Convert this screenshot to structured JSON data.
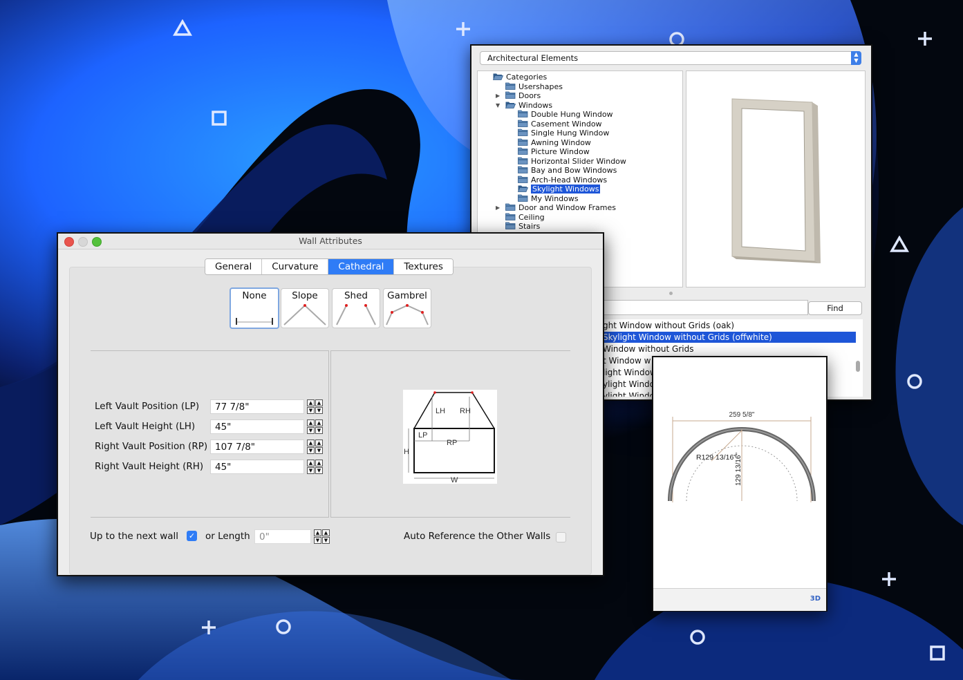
{
  "architectural_elements": {
    "category_select": "Architectural Elements",
    "tree": [
      {
        "label": "Categories",
        "indent": 0,
        "arrow": "",
        "open": true,
        "selected": false
      },
      {
        "label": "Usershapes",
        "indent": 1,
        "arrow": "",
        "open": false,
        "selected": false
      },
      {
        "label": "Doors",
        "indent": 1,
        "arrow": "▶",
        "open": false,
        "selected": false
      },
      {
        "label": "Windows",
        "indent": 1,
        "arrow": "▼",
        "open": true,
        "selected": false
      },
      {
        "label": "Double Hung Window",
        "indent": 2,
        "arrow": "",
        "open": false,
        "selected": false
      },
      {
        "label": "Casement Window",
        "indent": 2,
        "arrow": "",
        "open": false,
        "selected": false
      },
      {
        "label": "Single Hung Window",
        "indent": 2,
        "arrow": "",
        "open": false,
        "selected": false
      },
      {
        "label": "Awning Window",
        "indent": 2,
        "arrow": "",
        "open": false,
        "selected": false
      },
      {
        "label": "Picture Window",
        "indent": 2,
        "arrow": "",
        "open": false,
        "selected": false
      },
      {
        "label": "Horizontal Slider Window",
        "indent": 2,
        "arrow": "",
        "open": false,
        "selected": false
      },
      {
        "label": "Bay and Bow Windows",
        "indent": 2,
        "arrow": "",
        "open": false,
        "selected": false
      },
      {
        "label": "Arch-Head Windows",
        "indent": 2,
        "arrow": "",
        "open": false,
        "selected": false
      },
      {
        "label": "Skylight Windows",
        "indent": 2,
        "arrow": "",
        "open": true,
        "selected": true
      },
      {
        "label": "My Windows",
        "indent": 2,
        "arrow": "",
        "open": false,
        "selected": false
      },
      {
        "label": "Door and Window Frames",
        "indent": 1,
        "arrow": "▶",
        "open": false,
        "selected": false
      },
      {
        "label": "Ceiling",
        "indent": 1,
        "arrow": "",
        "open": false,
        "selected": false
      },
      {
        "label": "Stairs",
        "indent": 1,
        "arrow": "",
        "open": false,
        "selected": false
      }
    ],
    "find_label": "Find",
    "results": [
      {
        "label": "ght Window without Grids (oak)",
        "selected": false
      },
      {
        "label": "Skylight Window without Grids (offwhite)",
        "selected": true
      },
      {
        "label": "Window without Grids",
        "selected": false
      },
      {
        "label": "t Window w",
        "selected": false
      },
      {
        "label": "light Window",
        "selected": false
      },
      {
        "label": "ylight Windo",
        "selected": false
      },
      {
        "label": "ylight Windo",
        "selected": false
      }
    ]
  },
  "wall_attributes": {
    "title": "Wall Attributes",
    "tabs": [
      {
        "label": "General",
        "active": false
      },
      {
        "label": "Curvature",
        "active": false
      },
      {
        "label": "Cathedral",
        "active": true
      },
      {
        "label": "Textures",
        "active": false
      }
    ],
    "roof_types": [
      {
        "label": "None",
        "selected": true
      },
      {
        "label": "Slope",
        "selected": false
      },
      {
        "label": "Shed",
        "selected": false
      },
      {
        "label": "Gambrel",
        "selected": false
      }
    ],
    "fields": [
      {
        "label": "Left Vault Position (LP)",
        "value": "77 7/8\""
      },
      {
        "label": "Left Vault Height (LH)",
        "value": "45\""
      },
      {
        "label": "Right Vault Position (RP)",
        "value": "107 7/8\""
      },
      {
        "label": "Right Vault Height (RH)",
        "value": "45\""
      }
    ],
    "diagram_labels": {
      "lh": "LH",
      "rh": "RH",
      "lp": "LP",
      "rp": "RP",
      "h": "H",
      "w": "W"
    },
    "up_to_next_wall": {
      "label": "Up to the next wall",
      "checked": true
    },
    "or_length": {
      "label": "or Length",
      "value": "0\""
    },
    "auto_reference": {
      "label": "Auto Reference the Other Walls",
      "checked": false
    }
  },
  "arch_detail": {
    "width_dimension": "259 5/8\"",
    "radius_label": "R129 13/16\"",
    "height_dimension": "129 13/16\"",
    "view_button": "3D"
  },
  "colors": {
    "accent": "#2f7cf6",
    "selection": "#1e56d8",
    "marker_red": "#e02020"
  },
  "decorations": [
    "triangle-outline",
    "plus-sign",
    "circle-outline",
    "square-outline"
  ]
}
